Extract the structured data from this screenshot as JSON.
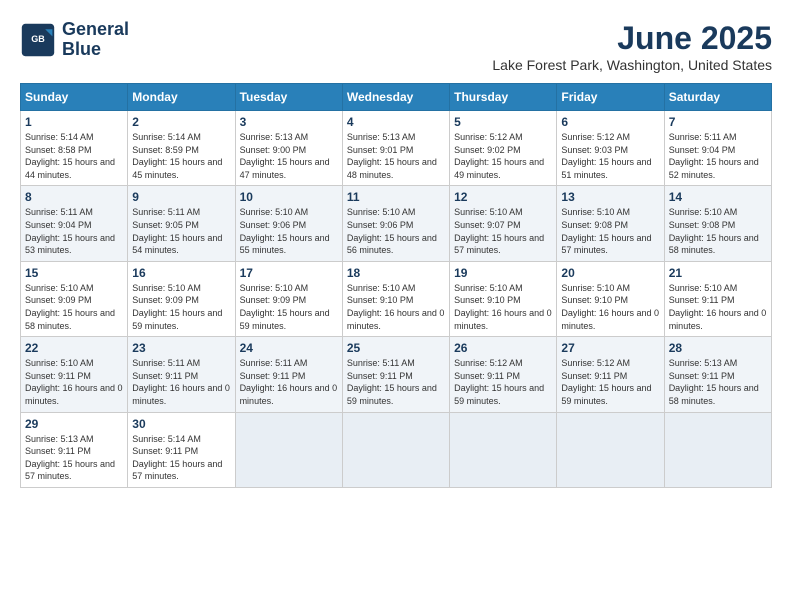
{
  "logo": {
    "line1": "General",
    "line2": "Blue"
  },
  "title": "June 2025",
  "subtitle": "Lake Forest Park, Washington, United States",
  "days_of_week": [
    "Sunday",
    "Monday",
    "Tuesday",
    "Wednesday",
    "Thursday",
    "Friday",
    "Saturday"
  ],
  "weeks": [
    [
      {
        "day": "1",
        "sunrise": "5:14 AM",
        "sunset": "8:58 PM",
        "daylight": "15 hours and 44 minutes."
      },
      {
        "day": "2",
        "sunrise": "5:14 AM",
        "sunset": "8:59 PM",
        "daylight": "15 hours and 45 minutes."
      },
      {
        "day": "3",
        "sunrise": "5:13 AM",
        "sunset": "9:00 PM",
        "daylight": "15 hours and 47 minutes."
      },
      {
        "day": "4",
        "sunrise": "5:13 AM",
        "sunset": "9:01 PM",
        "daylight": "15 hours and 48 minutes."
      },
      {
        "day": "5",
        "sunrise": "5:12 AM",
        "sunset": "9:02 PM",
        "daylight": "15 hours and 49 minutes."
      },
      {
        "day": "6",
        "sunrise": "5:12 AM",
        "sunset": "9:03 PM",
        "daylight": "15 hours and 51 minutes."
      },
      {
        "day": "7",
        "sunrise": "5:11 AM",
        "sunset": "9:04 PM",
        "daylight": "15 hours and 52 minutes."
      }
    ],
    [
      {
        "day": "8",
        "sunrise": "5:11 AM",
        "sunset": "9:04 PM",
        "daylight": "15 hours and 53 minutes."
      },
      {
        "day": "9",
        "sunrise": "5:11 AM",
        "sunset": "9:05 PM",
        "daylight": "15 hours and 54 minutes."
      },
      {
        "day": "10",
        "sunrise": "5:10 AM",
        "sunset": "9:06 PM",
        "daylight": "15 hours and 55 minutes."
      },
      {
        "day": "11",
        "sunrise": "5:10 AM",
        "sunset": "9:06 PM",
        "daylight": "15 hours and 56 minutes."
      },
      {
        "day": "12",
        "sunrise": "5:10 AM",
        "sunset": "9:07 PM",
        "daylight": "15 hours and 57 minutes."
      },
      {
        "day": "13",
        "sunrise": "5:10 AM",
        "sunset": "9:08 PM",
        "daylight": "15 hours and 57 minutes."
      },
      {
        "day": "14",
        "sunrise": "5:10 AM",
        "sunset": "9:08 PM",
        "daylight": "15 hours and 58 minutes."
      }
    ],
    [
      {
        "day": "15",
        "sunrise": "5:10 AM",
        "sunset": "9:09 PM",
        "daylight": "15 hours and 58 minutes."
      },
      {
        "day": "16",
        "sunrise": "5:10 AM",
        "sunset": "9:09 PM",
        "daylight": "15 hours and 59 minutes."
      },
      {
        "day": "17",
        "sunrise": "5:10 AM",
        "sunset": "9:09 PM",
        "daylight": "15 hours and 59 minutes."
      },
      {
        "day": "18",
        "sunrise": "5:10 AM",
        "sunset": "9:10 PM",
        "daylight": "16 hours and 0 minutes."
      },
      {
        "day": "19",
        "sunrise": "5:10 AM",
        "sunset": "9:10 PM",
        "daylight": "16 hours and 0 minutes."
      },
      {
        "day": "20",
        "sunrise": "5:10 AM",
        "sunset": "9:10 PM",
        "daylight": "16 hours and 0 minutes."
      },
      {
        "day": "21",
        "sunrise": "5:10 AM",
        "sunset": "9:11 PM",
        "daylight": "16 hours and 0 minutes."
      }
    ],
    [
      {
        "day": "22",
        "sunrise": "5:10 AM",
        "sunset": "9:11 PM",
        "daylight": "16 hours and 0 minutes."
      },
      {
        "day": "23",
        "sunrise": "5:11 AM",
        "sunset": "9:11 PM",
        "daylight": "16 hours and 0 minutes."
      },
      {
        "day": "24",
        "sunrise": "5:11 AM",
        "sunset": "9:11 PM",
        "daylight": "16 hours and 0 minutes."
      },
      {
        "day": "25",
        "sunrise": "5:11 AM",
        "sunset": "9:11 PM",
        "daylight": "15 hours and 59 minutes."
      },
      {
        "day": "26",
        "sunrise": "5:12 AM",
        "sunset": "9:11 PM",
        "daylight": "15 hours and 59 minutes."
      },
      {
        "day": "27",
        "sunrise": "5:12 AM",
        "sunset": "9:11 PM",
        "daylight": "15 hours and 59 minutes."
      },
      {
        "day": "28",
        "sunrise": "5:13 AM",
        "sunset": "9:11 PM",
        "daylight": "15 hours and 58 minutes."
      }
    ],
    [
      {
        "day": "29",
        "sunrise": "5:13 AM",
        "sunset": "9:11 PM",
        "daylight": "15 hours and 57 minutes."
      },
      {
        "day": "30",
        "sunrise": "5:14 AM",
        "sunset": "9:11 PM",
        "daylight": "15 hours and 57 minutes."
      },
      null,
      null,
      null,
      null,
      null
    ]
  ]
}
